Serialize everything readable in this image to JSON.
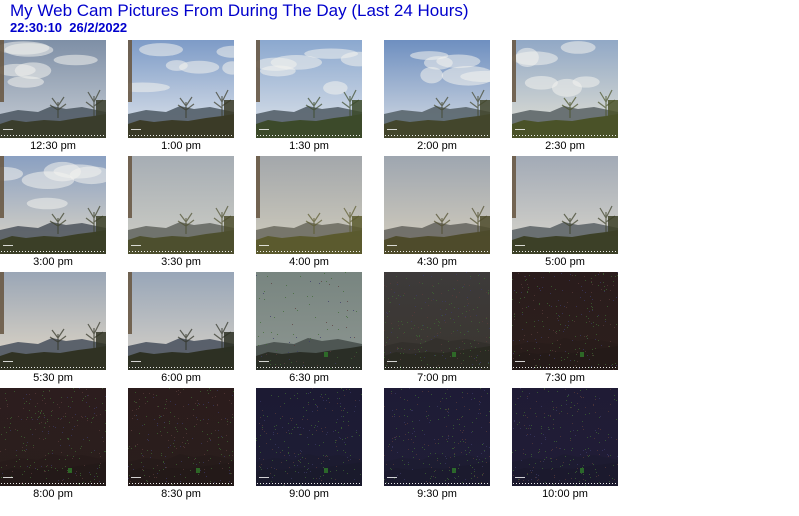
{
  "page": {
    "title": "My Web Cam Pictures From During The Day (Last 24 Hours)",
    "timestamp": "22:30:10  26/2/2022"
  },
  "colors": {
    "heading": "#0000cc"
  },
  "pictures": [
    {
      "label": "12:30 pm",
      "sky_top": "#7e8fa6",
      "sky_bottom": "#c9cfd6",
      "ground": "#3a3d2c",
      "hills": "#55606a",
      "frame": true,
      "clouds": true,
      "bright": true,
      "noise": "none"
    },
    {
      "label": "1:00 pm",
      "sky_top": "#7d9bc7",
      "sky_bottom": "#e1e6ec",
      "ground": "#3b3b27",
      "hills": "#59646f",
      "frame": true,
      "clouds": true,
      "bright": true,
      "noise": "none"
    },
    {
      "label": "1:30 pm",
      "sky_top": "#8ba8cf",
      "sky_bottom": "#dfe4ea",
      "ground": "#3c4a2a",
      "hills": "#5b6670",
      "frame": true,
      "clouds": true,
      "bright": true,
      "noise": "none"
    },
    {
      "label": "2:00 pm",
      "sky_top": "#6e8fc0",
      "sky_bottom": "#d7dde4",
      "ground": "#43462c",
      "hills": "#5e6a72",
      "frame": false,
      "clouds": true,
      "bright": true,
      "noise": "none"
    },
    {
      "label": "2:30 pm",
      "sky_top": "#91a8c6",
      "sky_bottom": "#e4e2d5",
      "ground": "#4a5228",
      "hills": "#646d6f",
      "frame": true,
      "clouds": true,
      "bright": true,
      "noise": "none"
    },
    {
      "label": "3:00 pm",
      "sky_top": "#8aa0c2",
      "sky_bottom": "#ddd6c6",
      "ground": "#3b3f27",
      "hills": "#585f66",
      "frame": true,
      "clouds": true,
      "bright": true,
      "noise": "none"
    },
    {
      "label": "3:30 pm",
      "sky_top": "#a6adb4",
      "sky_bottom": "#cfcfc6",
      "ground": "#4d4f2e",
      "hills": "#6b6f68",
      "frame": true,
      "clouds": false,
      "bright": true,
      "noise": "none"
    },
    {
      "label": "4:00 pm",
      "sky_top": "#a3a7ab",
      "sky_bottom": "#d1cdbd",
      "ground": "#5b5a2e",
      "hills": "#737266",
      "frame": true,
      "clouds": false,
      "bright": true,
      "noise": "none"
    },
    {
      "label": "4:30 pm",
      "sky_top": "#9ea6b0",
      "sky_bottom": "#d5cebd",
      "ground": "#4e4b2b",
      "hills": "#6e6d66",
      "frame": false,
      "clouds": false,
      "bright": true,
      "noise": "none"
    },
    {
      "label": "5:00 pm",
      "sky_top": "#a2aab6",
      "sky_bottom": "#d9d6cc",
      "ground": "#3c4027",
      "hills": "#646a6e",
      "frame": true,
      "clouds": false,
      "bright": true,
      "noise": "none"
    },
    {
      "label": "5:30 pm",
      "sky_top": "#9aa6b6",
      "sky_bottom": "#e2d8c6",
      "ground": "#303223",
      "hills": "#545c66",
      "frame": true,
      "clouds": false,
      "bright": true,
      "noise": "none"
    },
    {
      "label": "6:00 pm",
      "sky_top": "#98a6b8",
      "sky_bottom": "#d8d2c8",
      "ground": "#2d3023",
      "hills": "#535b66",
      "frame": true,
      "clouds": false,
      "bright": true,
      "noise": "none"
    },
    {
      "label": "6:30 pm",
      "sky_top": "#788580",
      "sky_bottom": "#8d9691",
      "ground": "#2a2e26",
      "hills": "#4b5350",
      "frame": false,
      "clouds": false,
      "bright": false,
      "noise": "light"
    },
    {
      "label": "7:00 pm",
      "sky_top": "#3d3a3a",
      "sky_bottom": "#3a3630",
      "ground": "#2a2a22",
      "hills": "#332f2c",
      "frame": false,
      "clouds": false,
      "bright": false,
      "noise": "heavy"
    },
    {
      "label": "7:30 pm",
      "sky_top": "#2a1c1c",
      "sky_bottom": "#2c1f1c",
      "ground": "#241a18",
      "hills": "#281c1a",
      "frame": false,
      "clouds": false,
      "bright": false,
      "noise": "heavy"
    },
    {
      "label": "8:00 pm",
      "sky_top": "#2c1d1e",
      "sky_bottom": "#2a1e1c",
      "ground": "#231918",
      "hills": "#271b1a",
      "frame": false,
      "clouds": false,
      "bright": false,
      "noise": "heavy"
    },
    {
      "label": "8:30 pm",
      "sky_top": "#2b1c1c",
      "sky_bottom": "#2a1e1c",
      "ground": "#231918",
      "hills": "#261b1a",
      "frame": false,
      "clouds": false,
      "bright": false,
      "noise": "heavy"
    },
    {
      "label": "9:00 pm",
      "sky_top": "#1c1a33",
      "sky_bottom": "#1e1d35",
      "ground": "#1a1a2c",
      "hills": "#1c1b30",
      "frame": false,
      "clouds": false,
      "bright": false,
      "noise": "heavy"
    },
    {
      "label": "9:30 pm",
      "sky_top": "#1e1b36",
      "sky_bottom": "#201e37",
      "ground": "#1b1a2e",
      "hills": "#1d1c32",
      "frame": false,
      "clouds": false,
      "bright": false,
      "noise": "heavy"
    },
    {
      "label": "10:00 pm",
      "sky_top": "#1f1b35",
      "sky_bottom": "#211d36",
      "ground": "#1b192d",
      "hills": "#1e1b31",
      "frame": false,
      "clouds": false,
      "bright": false,
      "noise": "heavy"
    }
  ]
}
